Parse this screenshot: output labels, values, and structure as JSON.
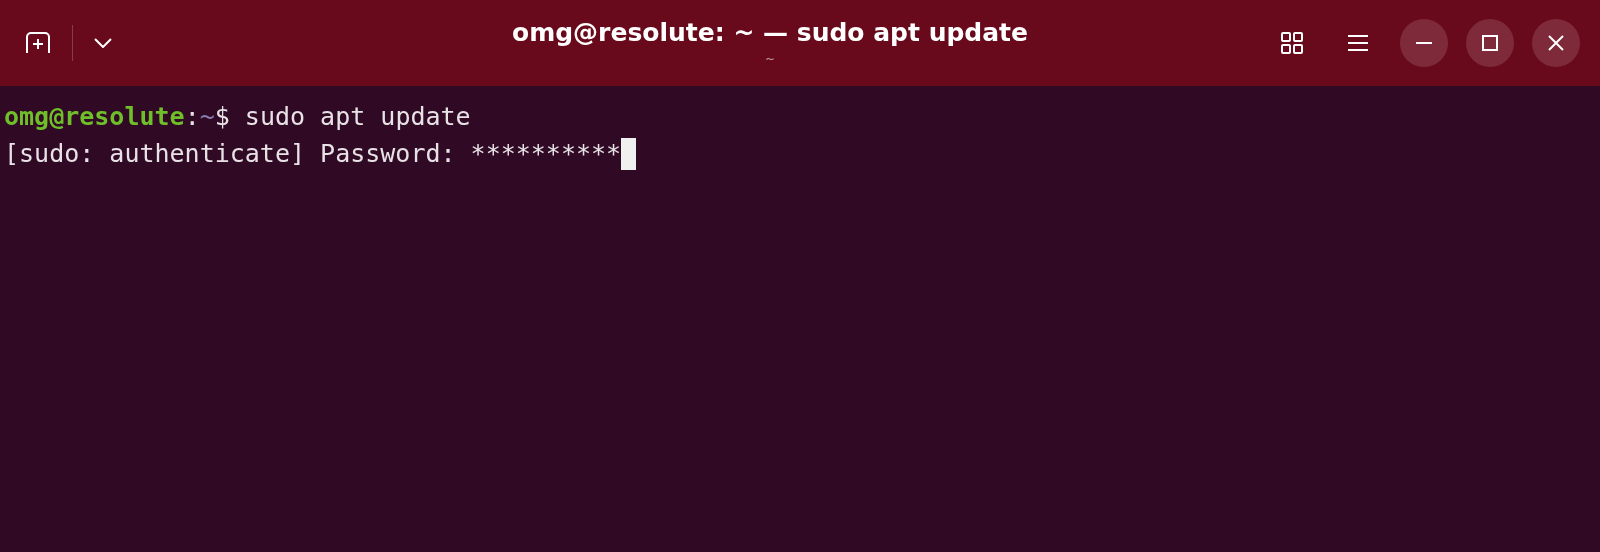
{
  "window": {
    "title": "omg@resolute: ~ — sudo apt update",
    "subtitle": "~"
  },
  "terminal": {
    "prompt": {
      "user_host": "omg@resolute",
      "separator": ":",
      "path": "~",
      "symbol": "$",
      "command": " sudo apt update"
    },
    "output_line": "[sudo: authenticate] Password: **********",
    "cursor_visible": true
  }
}
